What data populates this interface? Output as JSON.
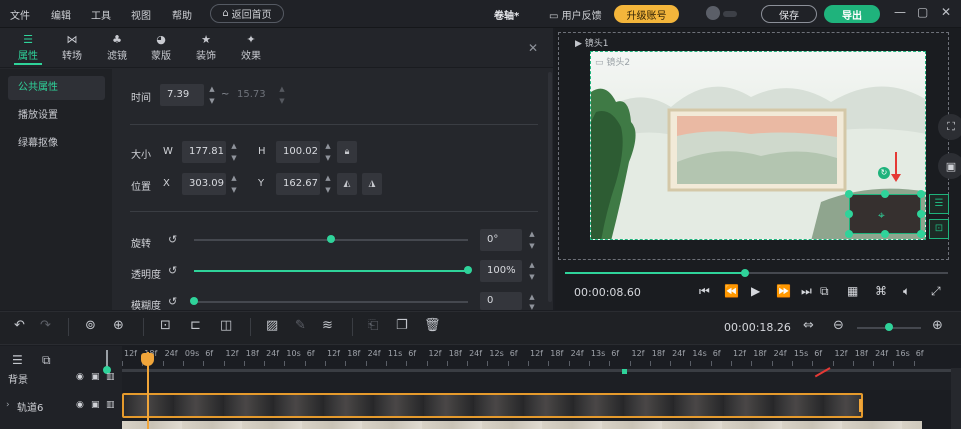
{
  "menu": {
    "file": "文件",
    "edit": "编辑",
    "tools": "工具",
    "view": "视图",
    "help": "帮助",
    "home_button": "返回首页"
  },
  "project_title": "卷轴*",
  "feedback": "用户反馈",
  "upgrade": "升级账号",
  "save": "保存",
  "export": "导出",
  "tabs": [
    {
      "label": "属性",
      "icon": "sliders-icon"
    },
    {
      "label": "转场",
      "icon": "transition-icon"
    },
    {
      "label": "滤镜",
      "icon": "filter-icon"
    },
    {
      "label": "蒙版",
      "icon": "mask-icon"
    },
    {
      "label": "装饰",
      "icon": "decoration-icon"
    },
    {
      "label": "效果",
      "icon": "effect-icon"
    }
  ],
  "subnav": [
    "公共属性",
    "播放设置",
    "绿幕抠像"
  ],
  "props": {
    "time_label": "时间",
    "time_start": "7.39",
    "time_sep": "~",
    "time_end": "15.73",
    "size_label": "大小",
    "w_label": "W",
    "w_value": "177.81",
    "h_label": "H",
    "h_value": "100.02",
    "pos_label": "位置",
    "x_label": "X",
    "x_value": "303.09",
    "y_label": "Y",
    "y_value": "162.67",
    "rotate_label": "旋转",
    "rotate_value": "0°",
    "rotate_level": 0.5,
    "opacity_label": "透明度",
    "opacity_value": "100%",
    "opacity_level": 1.0,
    "blur_label": "模糊度",
    "blur_value": "0",
    "blur_level": 0.0
  },
  "preview": {
    "lens_outer": "镜头1",
    "lens_inner": "镜头2",
    "current_time": "00:00:08.60",
    "progress": 0.47
  },
  "timeline": {
    "total_time": "00:00:18.26",
    "ruler_labels": [
      "12f",
      "18f",
      "24f",
      "09s",
      "6f",
      "12f",
      "18f",
      "24f",
      "10s",
      "6f",
      "12f",
      "18f",
      "24f",
      "11s",
      "6f",
      "12f",
      "18f",
      "24f",
      "12s",
      "6f",
      "12f",
      "18f",
      "24f",
      "13s",
      "6f",
      "12f",
      "18f",
      "24f",
      "14s",
      "6f",
      "12f",
      "18f",
      "24f",
      "15s",
      "6f",
      "12f",
      "18f",
      "24f",
      "16s",
      "6f"
    ],
    "tracks": [
      {
        "name": "背景"
      },
      {
        "name": "轨道6"
      }
    ],
    "zoom_level": 0.5
  },
  "colors": {
    "accent": "#2fd39a",
    "clip_border": "#e59a2c",
    "upgrade": "#f3b53b",
    "export": "#1fb37c"
  }
}
